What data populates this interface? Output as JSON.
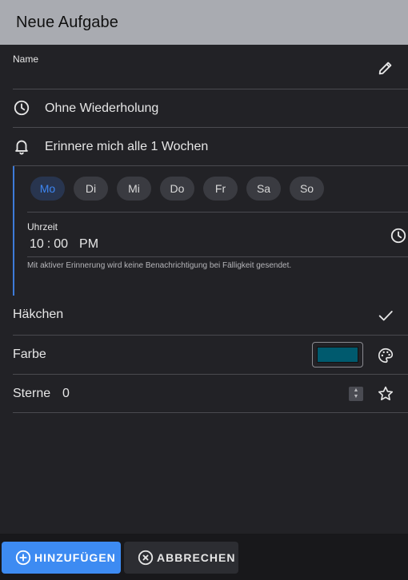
{
  "dialog": {
    "title": "Neue Aufgabe"
  },
  "name_field": {
    "label": "Name",
    "value": "",
    "icon": "pencil-icon"
  },
  "repeat": {
    "text": "Ohne Wiederholung",
    "icon": "clock-icon"
  },
  "reminder": {
    "text": "Erinnere mich alle 1 Wochen",
    "icon": "bell-icon",
    "accent_color": "#3d7bd9",
    "days": [
      {
        "label": "Mo",
        "selected": true
      },
      {
        "label": "Di",
        "selected": false
      },
      {
        "label": "Mi",
        "selected": false
      },
      {
        "label": "Do",
        "selected": false
      },
      {
        "label": "Fr",
        "selected": false
      },
      {
        "label": "Sa",
        "selected": false
      },
      {
        "label": "So",
        "selected": false
      }
    ],
    "time": {
      "label": "Uhrzeit",
      "hours": "10",
      "separator": ":",
      "minutes": "00",
      "ampm": "PM",
      "icon": "clock-icon"
    },
    "hint": "Mit aktiver Erinnerung wird keine Benachrichtigung bei Fälligkeit gesendet."
  },
  "checkmark": {
    "label": "Häkchen",
    "icon": "check-icon"
  },
  "color": {
    "label": "Farbe",
    "value": "#005a6e",
    "icon": "palette-icon"
  },
  "stars": {
    "label": "Sterne",
    "value": "0",
    "icon": "star-icon"
  },
  "actions": {
    "add": {
      "label": "HINZUFÜGEN",
      "icon": "add-circle-icon",
      "color": "#3d8bf2"
    },
    "cancel": {
      "label": "ABBRECHEN",
      "icon": "cancel-circle-icon"
    }
  }
}
